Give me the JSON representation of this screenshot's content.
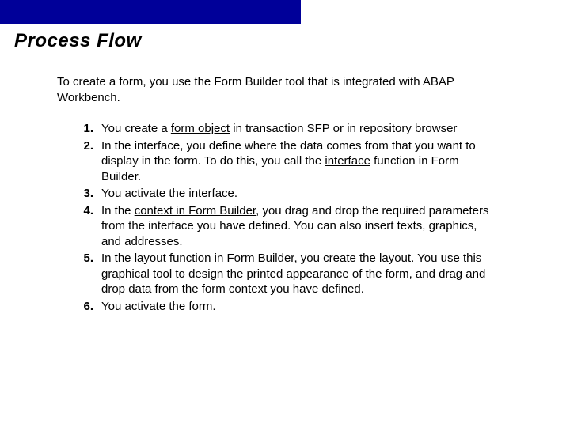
{
  "title": "Process Flow",
  "intro": "To create a form, you use the Form Builder tool that is integrated with ABAP Workbench.",
  "steps": {
    "s1": {
      "num": "1.",
      "pre": "You create a ",
      "link": "form object",
      "post": " in transaction SFP or in repository browser"
    },
    "s2": {
      "num": "2.",
      "pre": "In the interface, you define where the data comes from that you want to display in the form. To do this, you call the ",
      "link": "interface",
      "post": " function in Form Builder."
    },
    "s3": {
      "num": "3.",
      "text": "You activate the interface."
    },
    "s4": {
      "num": "4.",
      "pre": "In the ",
      "link": "context in Form Builder",
      "post": ", you drag and drop the required parameters from the interface you have defined. You can also insert texts, graphics, and addresses."
    },
    "s5": {
      "num": "5.",
      "pre": "In the ",
      "link": "layout",
      "post": " function in Form Builder, you create the layout. You use this graphical tool to design the printed appearance of the form, and drag and drop data from the form context you have defined."
    },
    "s6": {
      "num": "6.",
      "text": "You activate the form."
    }
  }
}
